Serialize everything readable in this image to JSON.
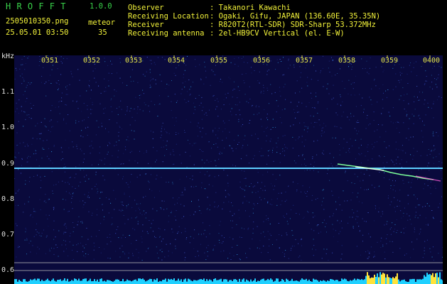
{
  "app": {
    "name": "H R O F F T",
    "version": "1.0.0"
  },
  "file": {
    "name": "2505010350.png",
    "datetime": "25.05.01 03:50"
  },
  "meteor": {
    "label": "meteor",
    "count": "35"
  },
  "info": [
    {
      "label": "Observer",
      "value": ": Takanori Kawachi"
    },
    {
      "label": "Receiving Location",
      "value": ": Ogaki, Gifu, JAPAN (136.60E, 35.35N)"
    },
    {
      "label": "Receiver",
      "value": ": R820T2(RTL-SDR) SDR-Sharp 53.372MHz"
    },
    {
      "label": "Receiving antenna",
      "value": ": 2el-HB9CV Vertical (el. E-W)"
    }
  ],
  "axis": {
    "yunit": "kHz",
    "yticks": [
      "1.1",
      "1.0",
      "0.9",
      "0.8",
      "0.7",
      "0.6"
    ],
    "xticks": [
      "0351",
      "0352",
      "0353",
      "0354",
      "0355",
      "0356",
      "0357",
      "0358",
      "0359",
      "0400"
    ]
  },
  "colors": {
    "background": "#0a0a3c",
    "header_green": "#39d24a",
    "header_yellow": "#f2f23a",
    "carrier": "#4ec8ff",
    "meteor_trail": "#7cff9a",
    "level_bar": "#1fd0ff",
    "level_peak": "#ffe23a"
  },
  "chart_data": {
    "type": "heatmap",
    "title": "",
    "xlabel": "",
    "ylabel": "kHz",
    "y_range": [
      0.58,
      1.16
    ],
    "x_ticks": [
      "0351",
      "0352",
      "0353",
      "0354",
      "0355",
      "0356",
      "0357",
      "0358",
      "0359",
      "0400"
    ],
    "carrier_freq_khz": 0.885,
    "meteor_trail": {
      "start_time": "0358",
      "end_time": "0400",
      "start_khz": 0.89,
      "end_khz": 0.855
    }
  }
}
